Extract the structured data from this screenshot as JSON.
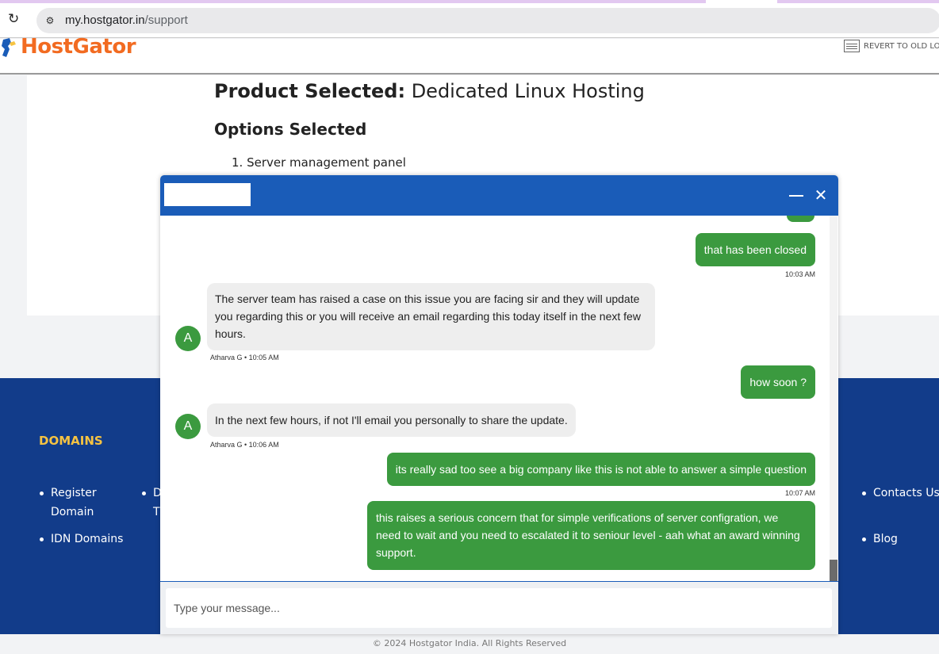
{
  "browser": {
    "url_host": "my.hostgator.in",
    "url_path": "/support",
    "reload_icon": "reload-icon",
    "site_info_icon": "site-info-icon"
  },
  "header": {
    "logo_text": "HostGator",
    "revert_label": "REVERT TO OLD LO"
  },
  "main": {
    "product_label": "Product Selected:",
    "product_value": "Dedicated Linux Hosting",
    "options_heading": "Options Selected",
    "options": [
      "1. Server management panel"
    ]
  },
  "footer": {
    "heading": "DOMAINS",
    "links": {
      "register_line1": "Register",
      "register_line2": "Domain",
      "idn": "IDN Domains",
      "partial_line1": "D",
      "partial_line2": "T",
      "contacts": "Contacts Us",
      "blog": "Blog"
    },
    "copyright": "© 2024 Hostgator India. All Rights Reserved"
  },
  "chat": {
    "minimize_icon": "minimize-icon",
    "close_icon": "close-icon",
    "close_glyph": "✕",
    "messages": [
      {
        "from": "user",
        "text": "that has been closed",
        "time": "10:03 AM"
      },
      {
        "from": "agent",
        "avatar": "A",
        "text": "The server team has raised a case on this issue you are facing sir and they will update you regarding this or you will receive an email regarding this today itself in the next few hours.",
        "meta": "Atharva G • 10:05 AM"
      },
      {
        "from": "user",
        "text": "how soon ?"
      },
      {
        "from": "agent",
        "avatar": "A",
        "text": "In the next few hours, if not I'll email you personally to share the update.",
        "meta": "Atharva G • 10:06 AM"
      },
      {
        "from": "user",
        "text": "its really sad too see a big company like this is not able to answer a simple question",
        "time": "10:07 AM"
      },
      {
        "from": "user",
        "text": "this raises a serious concern that for simple verifications of server configration, we need to wait and you need to escalated it to seniour level - aah what an award winning support."
      }
    ],
    "input_placeholder": "Type your message..."
  },
  "colors": {
    "brand_orange": "#f26b21",
    "chat_header_blue": "#1a5cb8",
    "user_bubble_green": "#3b9a3f",
    "footer_navy": "#123c8a",
    "footer_heading_yellow": "#f6c342"
  }
}
